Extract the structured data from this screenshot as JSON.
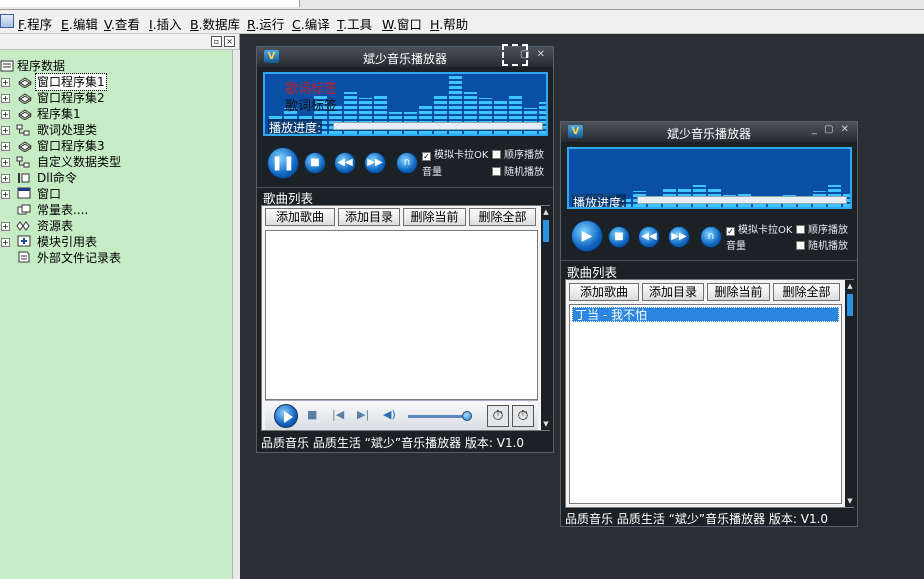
{
  "menubar": {
    "items": [
      {
        "key": "F",
        "label": ".程序"
      },
      {
        "key": "E",
        "label": ".编辑"
      },
      {
        "key": "V",
        "label": ".查看"
      },
      {
        "key": "I",
        "label": ".插入"
      },
      {
        "key": "B",
        "label": ".数据库"
      },
      {
        "key": "R",
        "label": ".运行"
      },
      {
        "key": "C",
        "label": ".编译"
      },
      {
        "key": "T",
        "label": ".工具"
      },
      {
        "key": "W",
        "label": ".窗口"
      },
      {
        "key": "H",
        "label": ".帮助"
      }
    ]
  },
  "panel": {
    "pin_icon": "pin-icon",
    "close_icon": "close-icon",
    "tree": [
      {
        "label": "程序数据",
        "icon": "program-data-icon"
      },
      {
        "label": "窗口程序集1",
        "icon": "assembly-icon",
        "selected": true
      },
      {
        "label": "窗口程序集2",
        "icon": "assembly-icon"
      },
      {
        "label": "程序集1",
        "icon": "assembly-icon"
      },
      {
        "label": "歌词处理类",
        "icon": "class-icon"
      },
      {
        "label": "窗口程序集3",
        "icon": "assembly-icon"
      },
      {
        "label": "自定义数据类型",
        "icon": "class-icon"
      },
      {
        "label": "Dll命令",
        "icon": "dll-icon"
      },
      {
        "label": "窗口",
        "icon": "window-icon"
      },
      {
        "label": "常量表....",
        "icon": "constant-icon"
      },
      {
        "label": "资源表",
        "icon": "resource-icon"
      },
      {
        "label": "模块引用表",
        "icon": "module-icon"
      },
      {
        "label": "外部文件记录表",
        "icon": "file-icon"
      }
    ]
  },
  "player_left": {
    "title": "斌少音乐播放器",
    "lyric_1": "歌词标签",
    "lyric_2": "歌词标签",
    "progress_label": "播放进度:",
    "karaoke": "模拟卡拉OK",
    "karaoke_checked": true,
    "order": "顺序播放",
    "random": "随机播放",
    "volume": "音量",
    "list_title": "歌曲列表",
    "btn_add_song": "添加歌曲",
    "btn_add_dir": "添加目录",
    "btn_del_current": "删除当前",
    "btn_del_all": "删除全部",
    "footer": "品质音乐 品质生活 “斌少”音乐播放器 版本: V1.0",
    "media_volume_level": 0.9
  },
  "player_right": {
    "title": "斌少音乐播放器",
    "progress_label": "播放进度:",
    "karaoke": "模拟卡拉OK",
    "karaoke_checked": true,
    "order": "顺序播放",
    "random": "随机播放",
    "volume": "音量",
    "list_title": "歌曲列表",
    "btn_add_song": "添加歌曲",
    "btn_add_dir": "添加目录",
    "btn_del_current": "删除当前",
    "btn_del_all": "删除全部",
    "songs": [
      "丁当 - 我不怕"
    ],
    "footer": "品质音乐 品质生活 “斌少”音乐播放器 版本: V1.0"
  },
  "colors": {
    "tree_bg": "#c6ecc6",
    "viz_bg": "#0a4fa6",
    "viz_bar": "#3ec5ff",
    "player_bg": "#1c2126",
    "lyric_red": "#c0202a",
    "desktop": "#2b2e33"
  }
}
